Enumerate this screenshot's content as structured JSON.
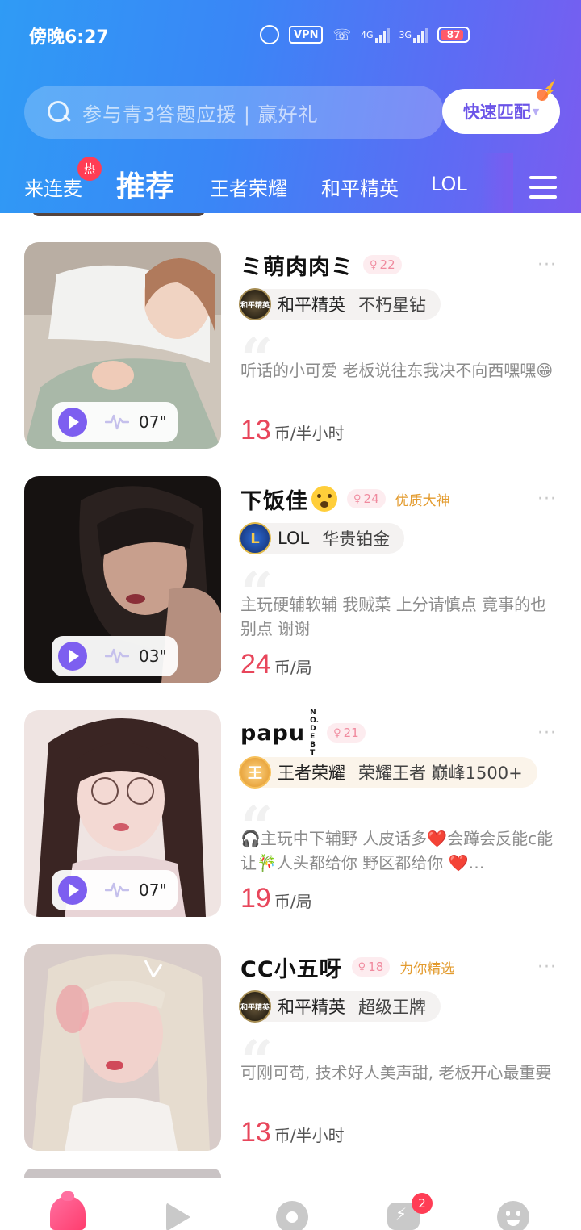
{
  "status_bar": {
    "time": "傍晚6:27",
    "vpn": "VPN",
    "net1": "4G",
    "net2": "3G",
    "battery": "87",
    "battery_level": 0.87
  },
  "search": {
    "placeholder": "参与青3答题应援 | 赢好礼",
    "quick_match": "快速匹配"
  },
  "tabs": [
    {
      "label": "来连麦",
      "badge": "热"
    },
    {
      "label": "推荐",
      "active": true
    },
    {
      "label": "王者荣耀"
    },
    {
      "label": "和平精英"
    },
    {
      "label": "LOL"
    }
  ],
  "colors": {
    "header_start": "#2f9bf5",
    "header_end": "#7a5cf0",
    "price": "#e8465b",
    "accent": "#7d5ff0"
  },
  "cards": [
    {
      "name": "ミ萌肉肉ミ",
      "age": "22",
      "gender": "female",
      "tag": "",
      "game_icon": "peace-elite-logo",
      "game_logo_text": "和平精英",
      "game": "和平精英",
      "rank": "不朽星钻",
      "intro": "听话的小可爱  老板说往东我决不向西嘿嘿😁",
      "price": "13",
      "unit": "币/半小时",
      "voice_duration": "07\""
    },
    {
      "name": "下饭佳",
      "age": "24",
      "gender": "female",
      "tag": "优质大神",
      "game_icon": "lol-logo",
      "game_logo_text": "L",
      "game": "LOL",
      "rank": "华贵铂金",
      "intro": "主玩硬辅软辅 我贼菜  上分请慎点 竟事的也别点 谢谢",
      "price": "24",
      "unit": "币/局",
      "voice_duration": "03\""
    },
    {
      "name": "papu",
      "name_tag": "NO.DEBT",
      "age": "21",
      "gender": "female",
      "tag": "",
      "game_icon": "honor-of-kings-logo",
      "game_logo_text": "王",
      "game": "王者荣耀",
      "rank": "荣耀王者  巅峰1500+",
      "intro": "🎧主玩中下辅野 人皮话多❤️会蹲会反能c能让🎋人头都给你 野区都给你 ❤️…",
      "price": "19",
      "unit": "币/局",
      "voice_duration": "07\""
    },
    {
      "name": "CC小五呀",
      "age": "18",
      "gender": "female",
      "tag": "为你精选",
      "game_icon": "peace-elite-logo",
      "game_logo_text": "和平精英",
      "game": "和平精英",
      "rank": "超级王牌",
      "intro": "可刚可苟, 技术好人美声甜, 老板开心最重要",
      "price": "13",
      "unit": "币/半小时",
      "voice_duration": "07\""
    }
  ],
  "bottom_nav": {
    "items": [
      "home-icon",
      "play-icon",
      "record-icon",
      "message-icon",
      "profile-icon"
    ],
    "message_badge": "2"
  }
}
